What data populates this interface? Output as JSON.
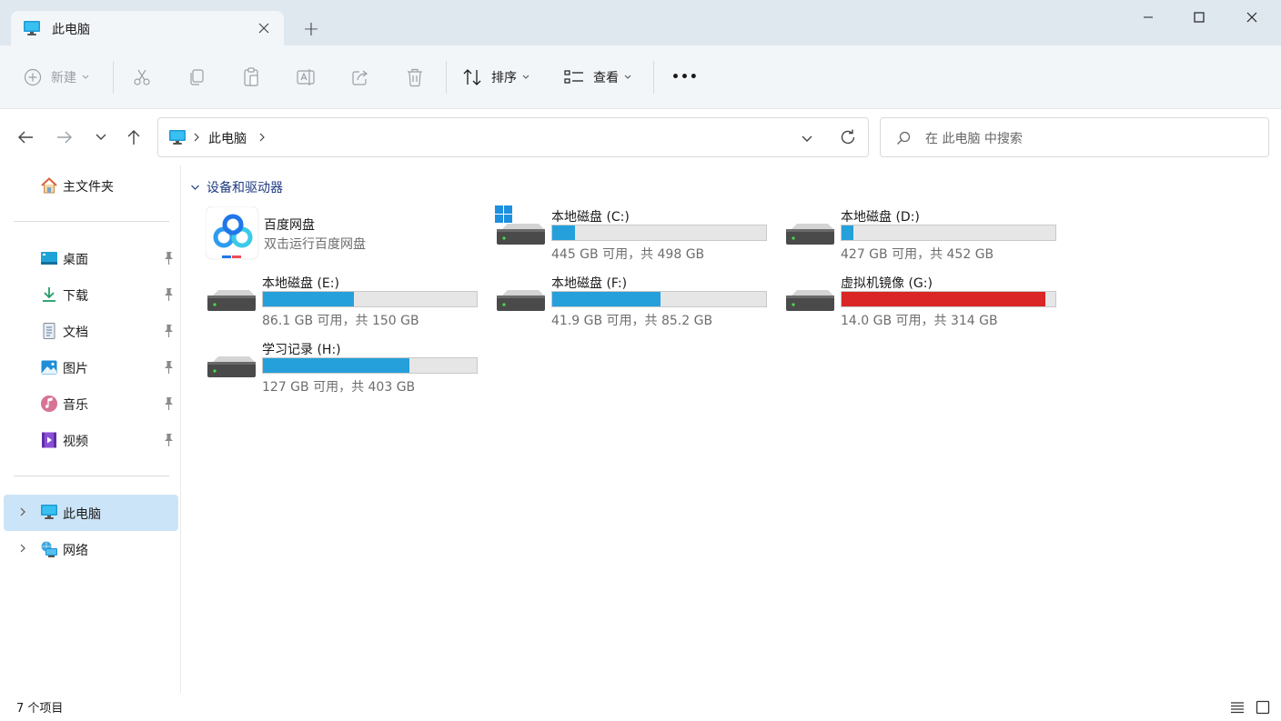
{
  "window": {
    "tab_title": "此电脑",
    "new_tab": "+"
  },
  "toolbar": {
    "new_label": "新建",
    "sort_label": "排序",
    "view_label": "查看",
    "more_label": "•••"
  },
  "address": {
    "location": "此电脑",
    "search_placeholder": "在 此电脑 中搜索"
  },
  "sidebar": {
    "home": "主文件夹",
    "quick_access": [
      {
        "label": "桌面",
        "icon": "desktop-icon"
      },
      {
        "label": "下载",
        "icon": "download-icon"
      },
      {
        "label": "文档",
        "icon": "document-icon"
      },
      {
        "label": "图片",
        "icon": "pictures-icon"
      },
      {
        "label": "音乐",
        "icon": "music-icon"
      },
      {
        "label": "视频",
        "icon": "video-icon"
      }
    ],
    "this_pc": "此电脑",
    "network": "网络"
  },
  "content": {
    "group_title": "设备和驱动器",
    "baidu": {
      "name": "百度网盘",
      "subtitle": "双击运行百度网盘"
    },
    "drives": [
      {
        "name": "本地磁盘 (C:)",
        "info": "445 GB 可用，共 498 GB",
        "used_fraction": 0.106
      },
      {
        "name": "本地磁盘 (D:)",
        "info": "427 GB 可用，共 452 GB",
        "used_fraction": 0.055
      },
      {
        "name": "本地磁盘 (E:)",
        "info": "86.1 GB 可用，共 150 GB",
        "used_fraction": 0.426
      },
      {
        "name": "本地磁盘 (F:)",
        "info": "41.9 GB 可用，共 85.2 GB",
        "used_fraction": 0.508
      },
      {
        "name": "虚拟机镜像 (G:)",
        "info": "14.0 GB 可用，共 314 GB",
        "used_fraction": 0.955
      },
      {
        "name": "学习记录 (H:)",
        "info": "127 GB 可用，共 403 GB",
        "used_fraction": 0.685
      }
    ]
  },
  "status": {
    "item_count": "7 个项目"
  },
  "colors": {
    "bar_normal": "#26a0da",
    "bar_full": "#da2626",
    "accent": "#0067c0"
  }
}
